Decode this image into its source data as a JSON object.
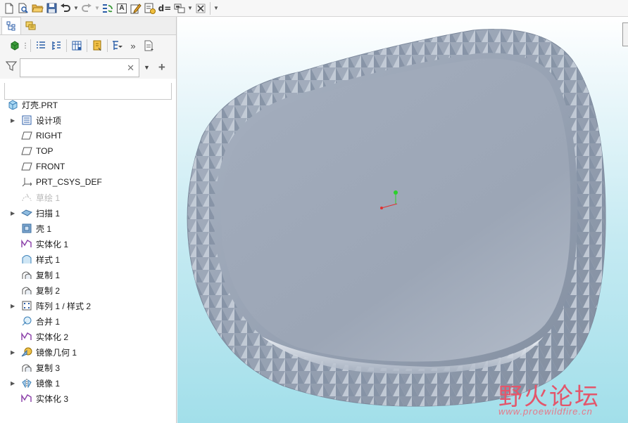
{
  "toolbar": {
    "icons": [
      "new-file",
      "open-zoom",
      "open-folder",
      "save",
      "undo",
      "redo",
      "regenerate",
      "annotation",
      "edit-definition",
      "checklist",
      "dimension",
      "layer",
      "close-window"
    ],
    "dim_label": "d=",
    "annotation_letter": "A"
  },
  "panel": {
    "tabs": [
      "model-tree",
      "layer-tree"
    ],
    "filter": {
      "value": "",
      "placeholder": ""
    }
  },
  "tree": {
    "root": {
      "label": "灯壳.PRT"
    },
    "items": [
      {
        "label": "设计项",
        "expandable": true,
        "icon": "design-items",
        "dim": false
      },
      {
        "label": "RIGHT",
        "expandable": false,
        "icon": "datum-plane",
        "dim": false
      },
      {
        "label": "TOP",
        "expandable": false,
        "icon": "datum-plane",
        "dim": false
      },
      {
        "label": "FRONT",
        "expandable": false,
        "icon": "datum-plane",
        "dim": false
      },
      {
        "label": "PRT_CSYS_DEF",
        "expandable": false,
        "icon": "coordinate-system",
        "dim": false
      },
      {
        "label": "草绘 1",
        "expandable": false,
        "icon": "sketch",
        "dim": true
      },
      {
        "label": "扫描 1",
        "expandable": true,
        "icon": "sweep",
        "dim": false
      },
      {
        "label": "壳 1",
        "expandable": false,
        "icon": "shell",
        "dim": false
      },
      {
        "label": "实体化 1",
        "expandable": false,
        "icon": "solidify",
        "dim": false
      },
      {
        "label": "样式 1",
        "expandable": false,
        "icon": "style",
        "dim": false
      },
      {
        "label": "复制 1",
        "expandable": false,
        "icon": "copy",
        "dim": false
      },
      {
        "label": "复制 2",
        "expandable": false,
        "icon": "copy",
        "dim": false
      },
      {
        "label": "阵列 1 / 样式 2",
        "expandable": true,
        "icon": "pattern",
        "dim": false
      },
      {
        "label": "合并 1",
        "expandable": false,
        "icon": "merge",
        "dim": false
      },
      {
        "label": "实体化 2",
        "expandable": false,
        "icon": "solidify",
        "dim": false
      },
      {
        "label": "镜像几何 1",
        "expandable": true,
        "icon": "mirror-geometry",
        "dim": false
      },
      {
        "label": "复制 3",
        "expandable": false,
        "icon": "copy",
        "dim": false
      },
      {
        "label": "镜像 1",
        "expandable": true,
        "icon": "mirror",
        "dim": false
      },
      {
        "label": "实体化 3",
        "expandable": false,
        "icon": "solidify",
        "dim": false
      }
    ]
  },
  "watermark": {
    "title": "野火论坛",
    "url": "www.proewildfire.cn"
  },
  "colors": {
    "model_surface": "#9aa6b6",
    "background_top": "#ffffff",
    "background_bottom": "#a2dfea",
    "insert_line": "#74b04c",
    "watermark": "#e3566b"
  }
}
